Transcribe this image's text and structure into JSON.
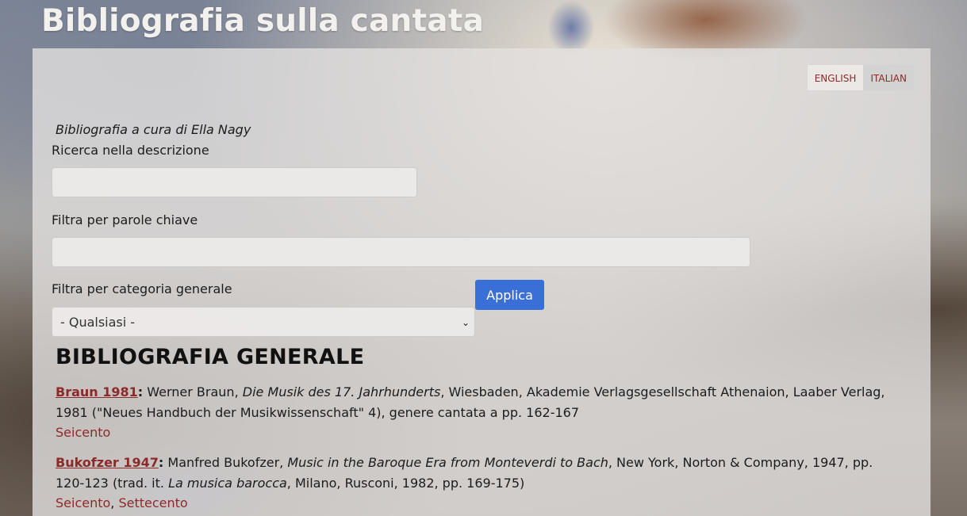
{
  "page": {
    "title": "Bibliografia sulla cantata"
  },
  "language_switch": {
    "english": "ENGLISH",
    "italian": "ITALIAN"
  },
  "credit": "Bibliografia a cura di Ella Nagy",
  "filters": {
    "search_label": "Ricerca nella descrizione",
    "search_value": "",
    "keywords_label": "Filtra per parole chiave",
    "keywords_value": "",
    "category_label": "Filtra per categoria generale",
    "category_selected": "- Qualsiasi -",
    "apply_label": "Applica"
  },
  "section_heading": "BIBLIOGRAFIA GENERALE",
  "entries": [
    {
      "ref": "Braun 1981",
      "colon": ":",
      "before_title": " Werner Braun, ",
      "title": "Die Musik des 17. Jahrhunderts",
      "after_title": ", Wiesbaden, Akademie Verlagsgesellschaft Athenaion, Laaber Verlag, 1981 (\"Neues Handbuch der Musikwissenschaft\" 4), genere cantata a pp. 162-167",
      "tags": [
        "Seicento"
      ]
    },
    {
      "ref": "Bukofzer 1947",
      "colon": ":",
      "before_title": " Manfred Bukofzer, ",
      "title": "Music in the Baroque Era from Monteverdi to Bach",
      "after_title": ", New York, Norton & Company, 1947, pp. 120-123 (trad. it. ",
      "title2": "La musica barocca",
      "after_title2": ", Milano, Rusconi, 1982, pp. 169-175)",
      "tags": [
        "Seicento",
        "Settecento"
      ],
      "tag_separator": ", "
    }
  ]
}
